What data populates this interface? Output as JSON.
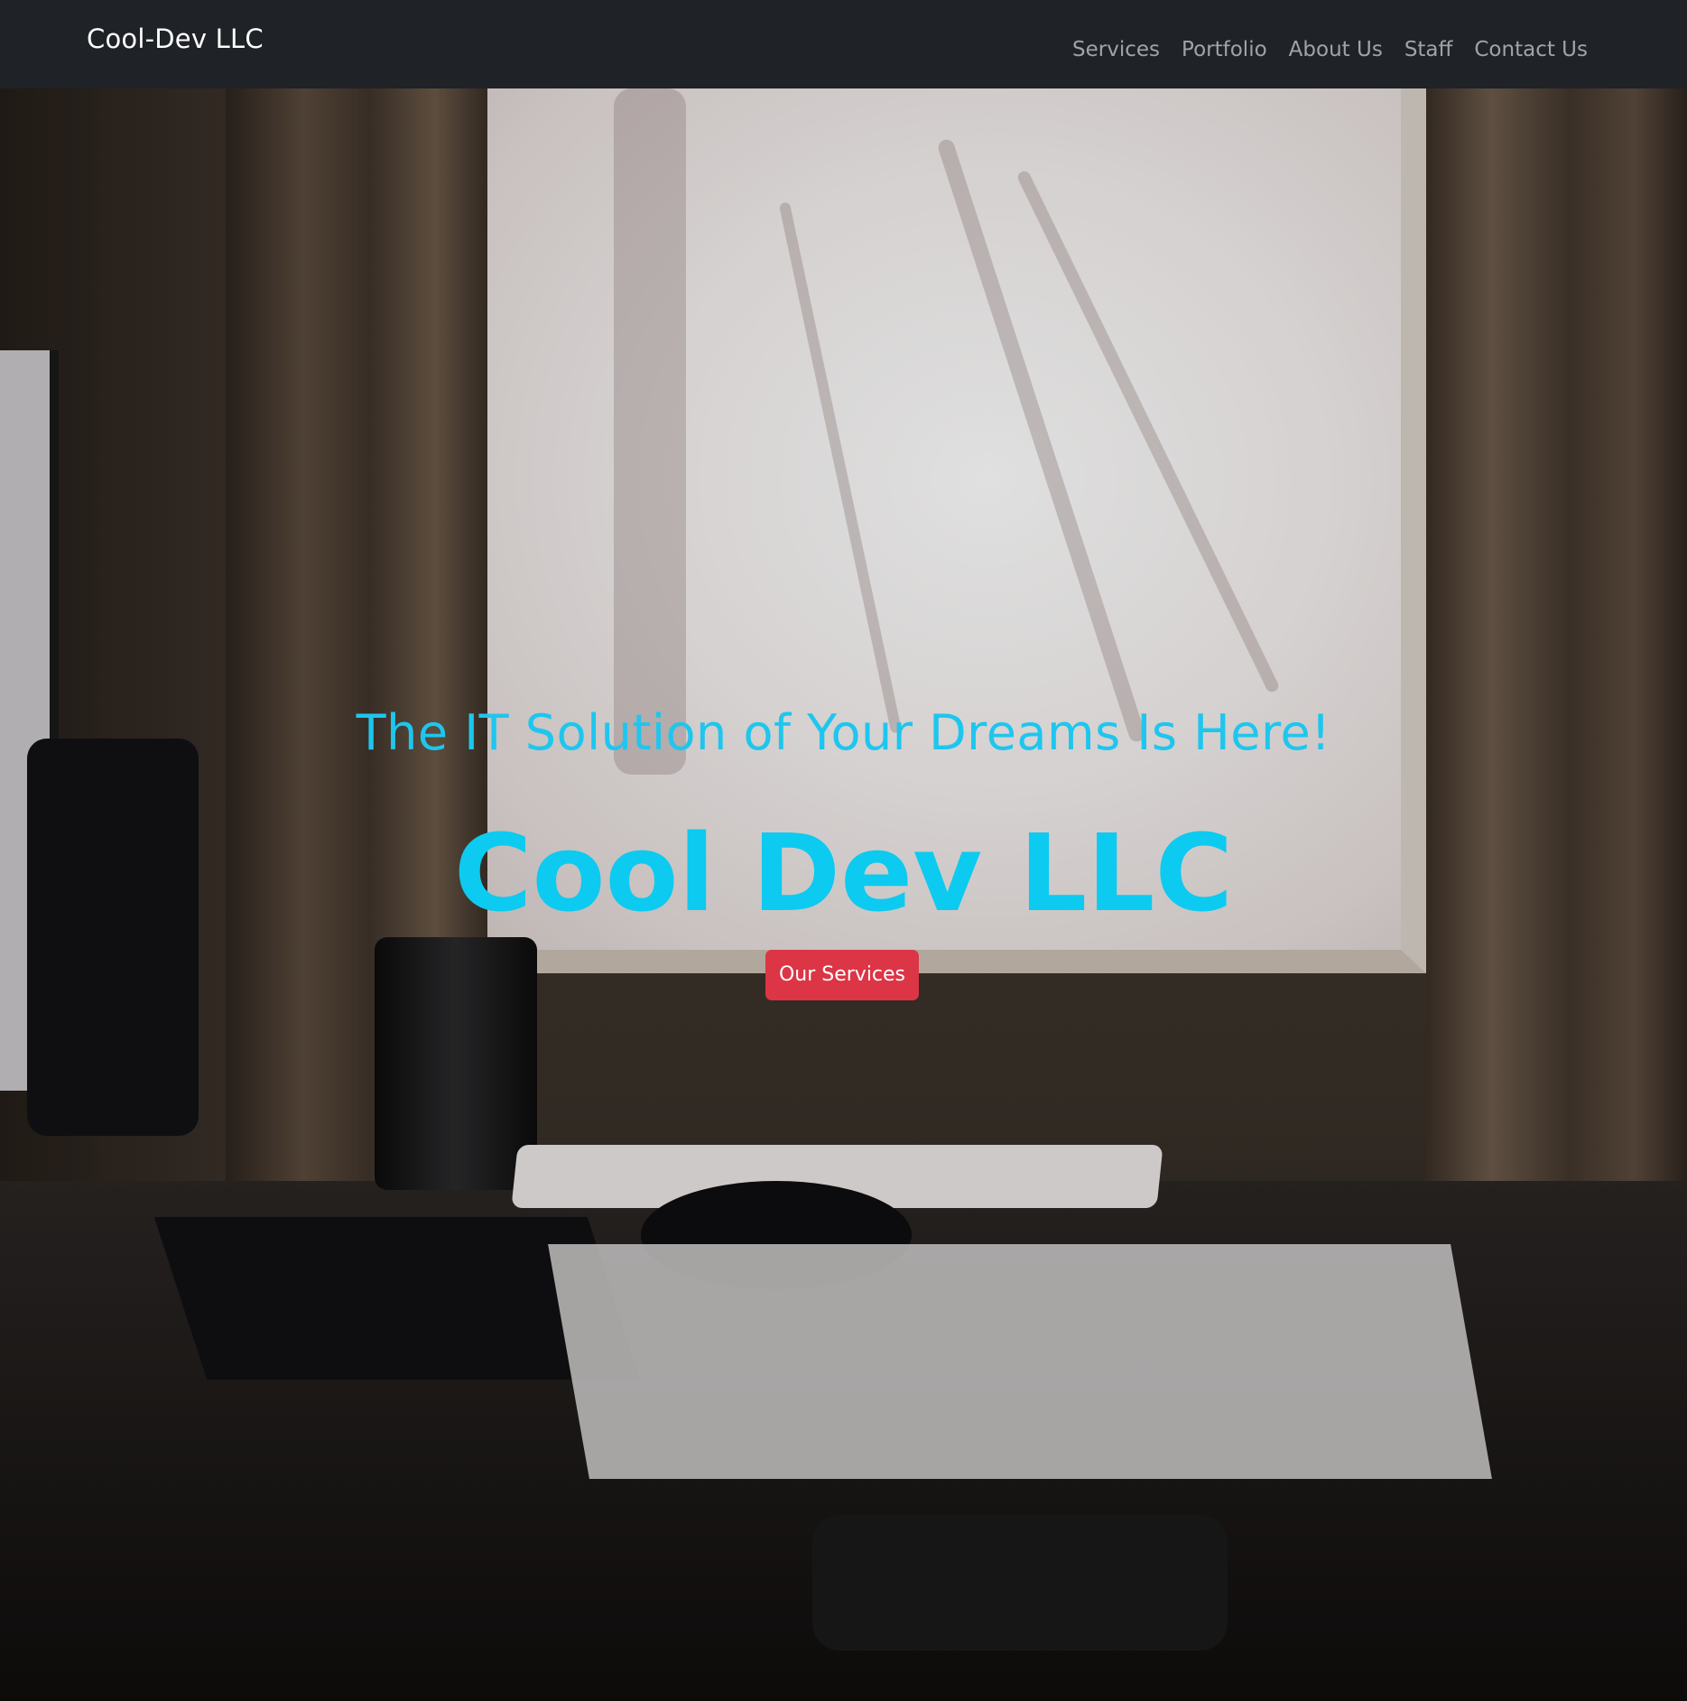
{
  "navbar": {
    "brand": "Cool-Dev LLC",
    "links": [
      {
        "label": "Services"
      },
      {
        "label": "Portfolio"
      },
      {
        "label": "About Us"
      },
      {
        "label": "Staff"
      },
      {
        "label": "Contact Us"
      }
    ]
  },
  "hero": {
    "tagline": "The IT Solution of Your Dreams Is Here!",
    "title": "Cool Dev LLC",
    "cta_label": "Our Services",
    "background_image": "desk-by-window-photo"
  },
  "colors": {
    "navbar_bg": "#1f2226",
    "accent_cyan": "#0dcaf0",
    "button_red": "#dc3545"
  }
}
